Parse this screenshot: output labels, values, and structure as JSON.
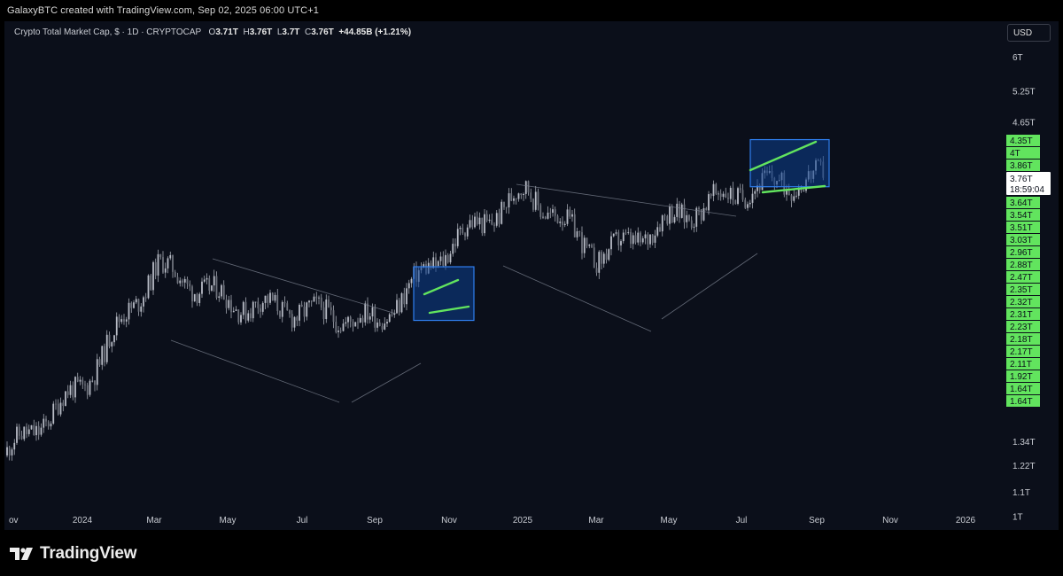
{
  "header": {
    "credit": "GalaxyBTC created with TradingView.com, Sep 02, 2025 06:00 UTC+1"
  },
  "legend": {
    "symbol": "Crypto Total Market Cap, $ · 1D · CRYPTOCAP",
    "open_k": "O",
    "open": "3.71T",
    "high_k": "H",
    "high": "3.76T",
    "low_k": "L",
    "low": "3.7T",
    "close_k": "C",
    "close": "3.76T",
    "change": "+44.85B (+1.21%)"
  },
  "currency_button": "USD",
  "price_tag": {
    "value": "3.76T",
    "countdown": "18:59:04"
  },
  "brand": {
    "name": "TradingView"
  },
  "colors": {
    "background": "#0b0f1a",
    "candles": "#b8bcc6",
    "pattern_lines": "#62e45e",
    "box_fill": "#0d3f8f",
    "box_border": "#2f7ff0",
    "trend_lines": "#7f8694",
    "badge": "#62e45e"
  },
  "icons": {
    "logo": "tradingview-logo-icon"
  },
  "chart_data": {
    "type": "candlestick",
    "title": "Crypto Total Market Cap, $ · 1D · CRYPTOCAP",
    "interval": "1D",
    "scale": "log",
    "ylim": [
      0.95,
      6.9
    ],
    "y_unit": "T USD",
    "y_ticks": [
      {
        "label": "6T",
        "value": 6.0
      },
      {
        "label": "5.25T",
        "value": 5.25
      },
      {
        "label": "4.65T",
        "value": 4.65
      },
      {
        "label": "1.34T",
        "value": 1.34
      },
      {
        "label": "1.22T",
        "value": 1.22
      },
      {
        "label": "1.1T",
        "value": 1.1
      },
      {
        "label": "1T",
        "value": 1.0
      }
    ],
    "x_ticks": [
      "ov",
      "2024",
      "Mar",
      "May",
      "Jul",
      "Sep",
      "Nov",
      "2025",
      "Mar",
      "May",
      "Jul",
      "Sep",
      "Nov",
      "2026"
    ],
    "series": [
      {
        "points": [
          [
            "ov",
            1.27
          ],
          [
            "2024",
            1.68
          ],
          [
            "Mar",
            2.66
          ],
          [
            "May",
            2.3
          ],
          [
            "Jul",
            2.23
          ],
          [
            "Sep",
            2.14
          ],
          [
            "Nov",
            2.93
          ],
          [
            "2025",
            3.57
          ],
          [
            "Mar",
            2.75
          ],
          [
            "May",
            3.22
          ],
          [
            "Jul",
            3.6
          ],
          [
            "Sep",
            3.76
          ]
        ]
      }
    ],
    "last_price": {
      "value": 3.76,
      "label": "3.76T",
      "countdown": "18:59:04"
    },
    "price_badges": [
      {
        "label": "4.35T",
        "value": 4.35
      },
      {
        "label": "4T",
        "value": 4.0
      },
      {
        "label": "3.86T",
        "value": 3.86
      },
      {
        "label": "3.64T",
        "value": 3.64
      },
      {
        "label": "3.54T",
        "value": 3.54
      },
      {
        "label": "3.51T",
        "value": 3.51
      },
      {
        "label": "3.03T",
        "value": 3.03
      },
      {
        "label": "2.96T",
        "value": 2.96
      },
      {
        "label": "2.88T",
        "value": 2.88
      },
      {
        "label": "2.47T",
        "value": 2.47
      },
      {
        "label": "2.35T",
        "value": 2.35
      },
      {
        "label": "2.32T",
        "value": 2.32
      },
      {
        "label": "2.31T",
        "value": 2.31
      },
      {
        "label": "2.23T",
        "value": 2.23
      },
      {
        "label": "2.18T",
        "value": 2.18
      },
      {
        "label": "2.17T",
        "value": 2.17
      },
      {
        "label": "2.11T",
        "value": 2.11
      },
      {
        "label": "1.92T",
        "value": 1.92
      },
      {
        "label": "1.64T",
        "value": 1.64
      },
      {
        "label": "1.64T",
        "value": 1.64
      }
    ],
    "annotations": [
      {
        "type": "pattern_box",
        "from": "Sep 2024",
        "to": "Oct 2024",
        "low": 2.15,
        "high": 2.65
      },
      {
        "type": "pattern_box",
        "from": "Jul 2025",
        "to": "Aug 2025",
        "low": 3.62,
        "high": 4.35
      }
    ]
  }
}
